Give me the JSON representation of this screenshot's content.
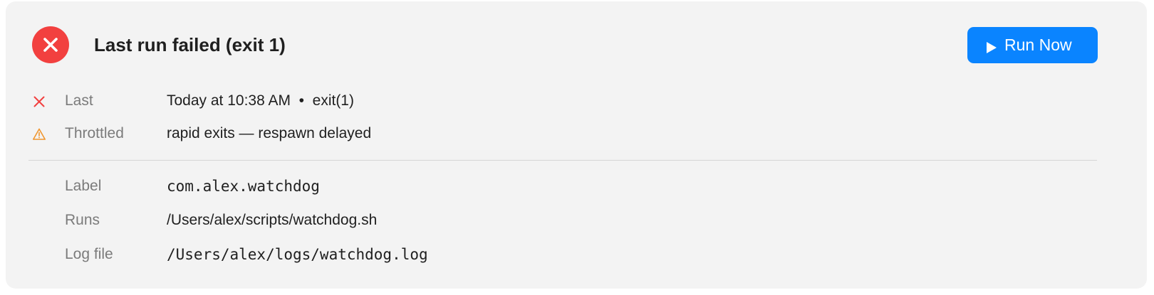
{
  "header": {
    "status_icon": "error-circle-x-icon",
    "title": "Last run failed (exit 1)",
    "run_button": {
      "icon": "play-icon",
      "label": "Run Now"
    }
  },
  "status_rows": [
    {
      "icon": "x-mark-icon",
      "label": "Last",
      "value": "Today at 10:38 AM  •  exit(1)"
    },
    {
      "icon": "warning-triangle-icon",
      "label": "Throttled",
      "value": "rapid exits — respawn delayed"
    }
  ],
  "detail_rows": [
    {
      "label": "Label",
      "value": "com.alex.watchdog"
    },
    {
      "label": "Runs",
      "value": "/Users/alex/scripts/watchdog.sh"
    },
    {
      "label": "Log file",
      "value": "/Users/alex/logs/watchdog.log"
    }
  ],
  "colors": {
    "card_background": "#f3f3f3",
    "error_red": "#f2403f",
    "warning_orange": "#f0962f",
    "accent_blue": "#0a84ff"
  }
}
